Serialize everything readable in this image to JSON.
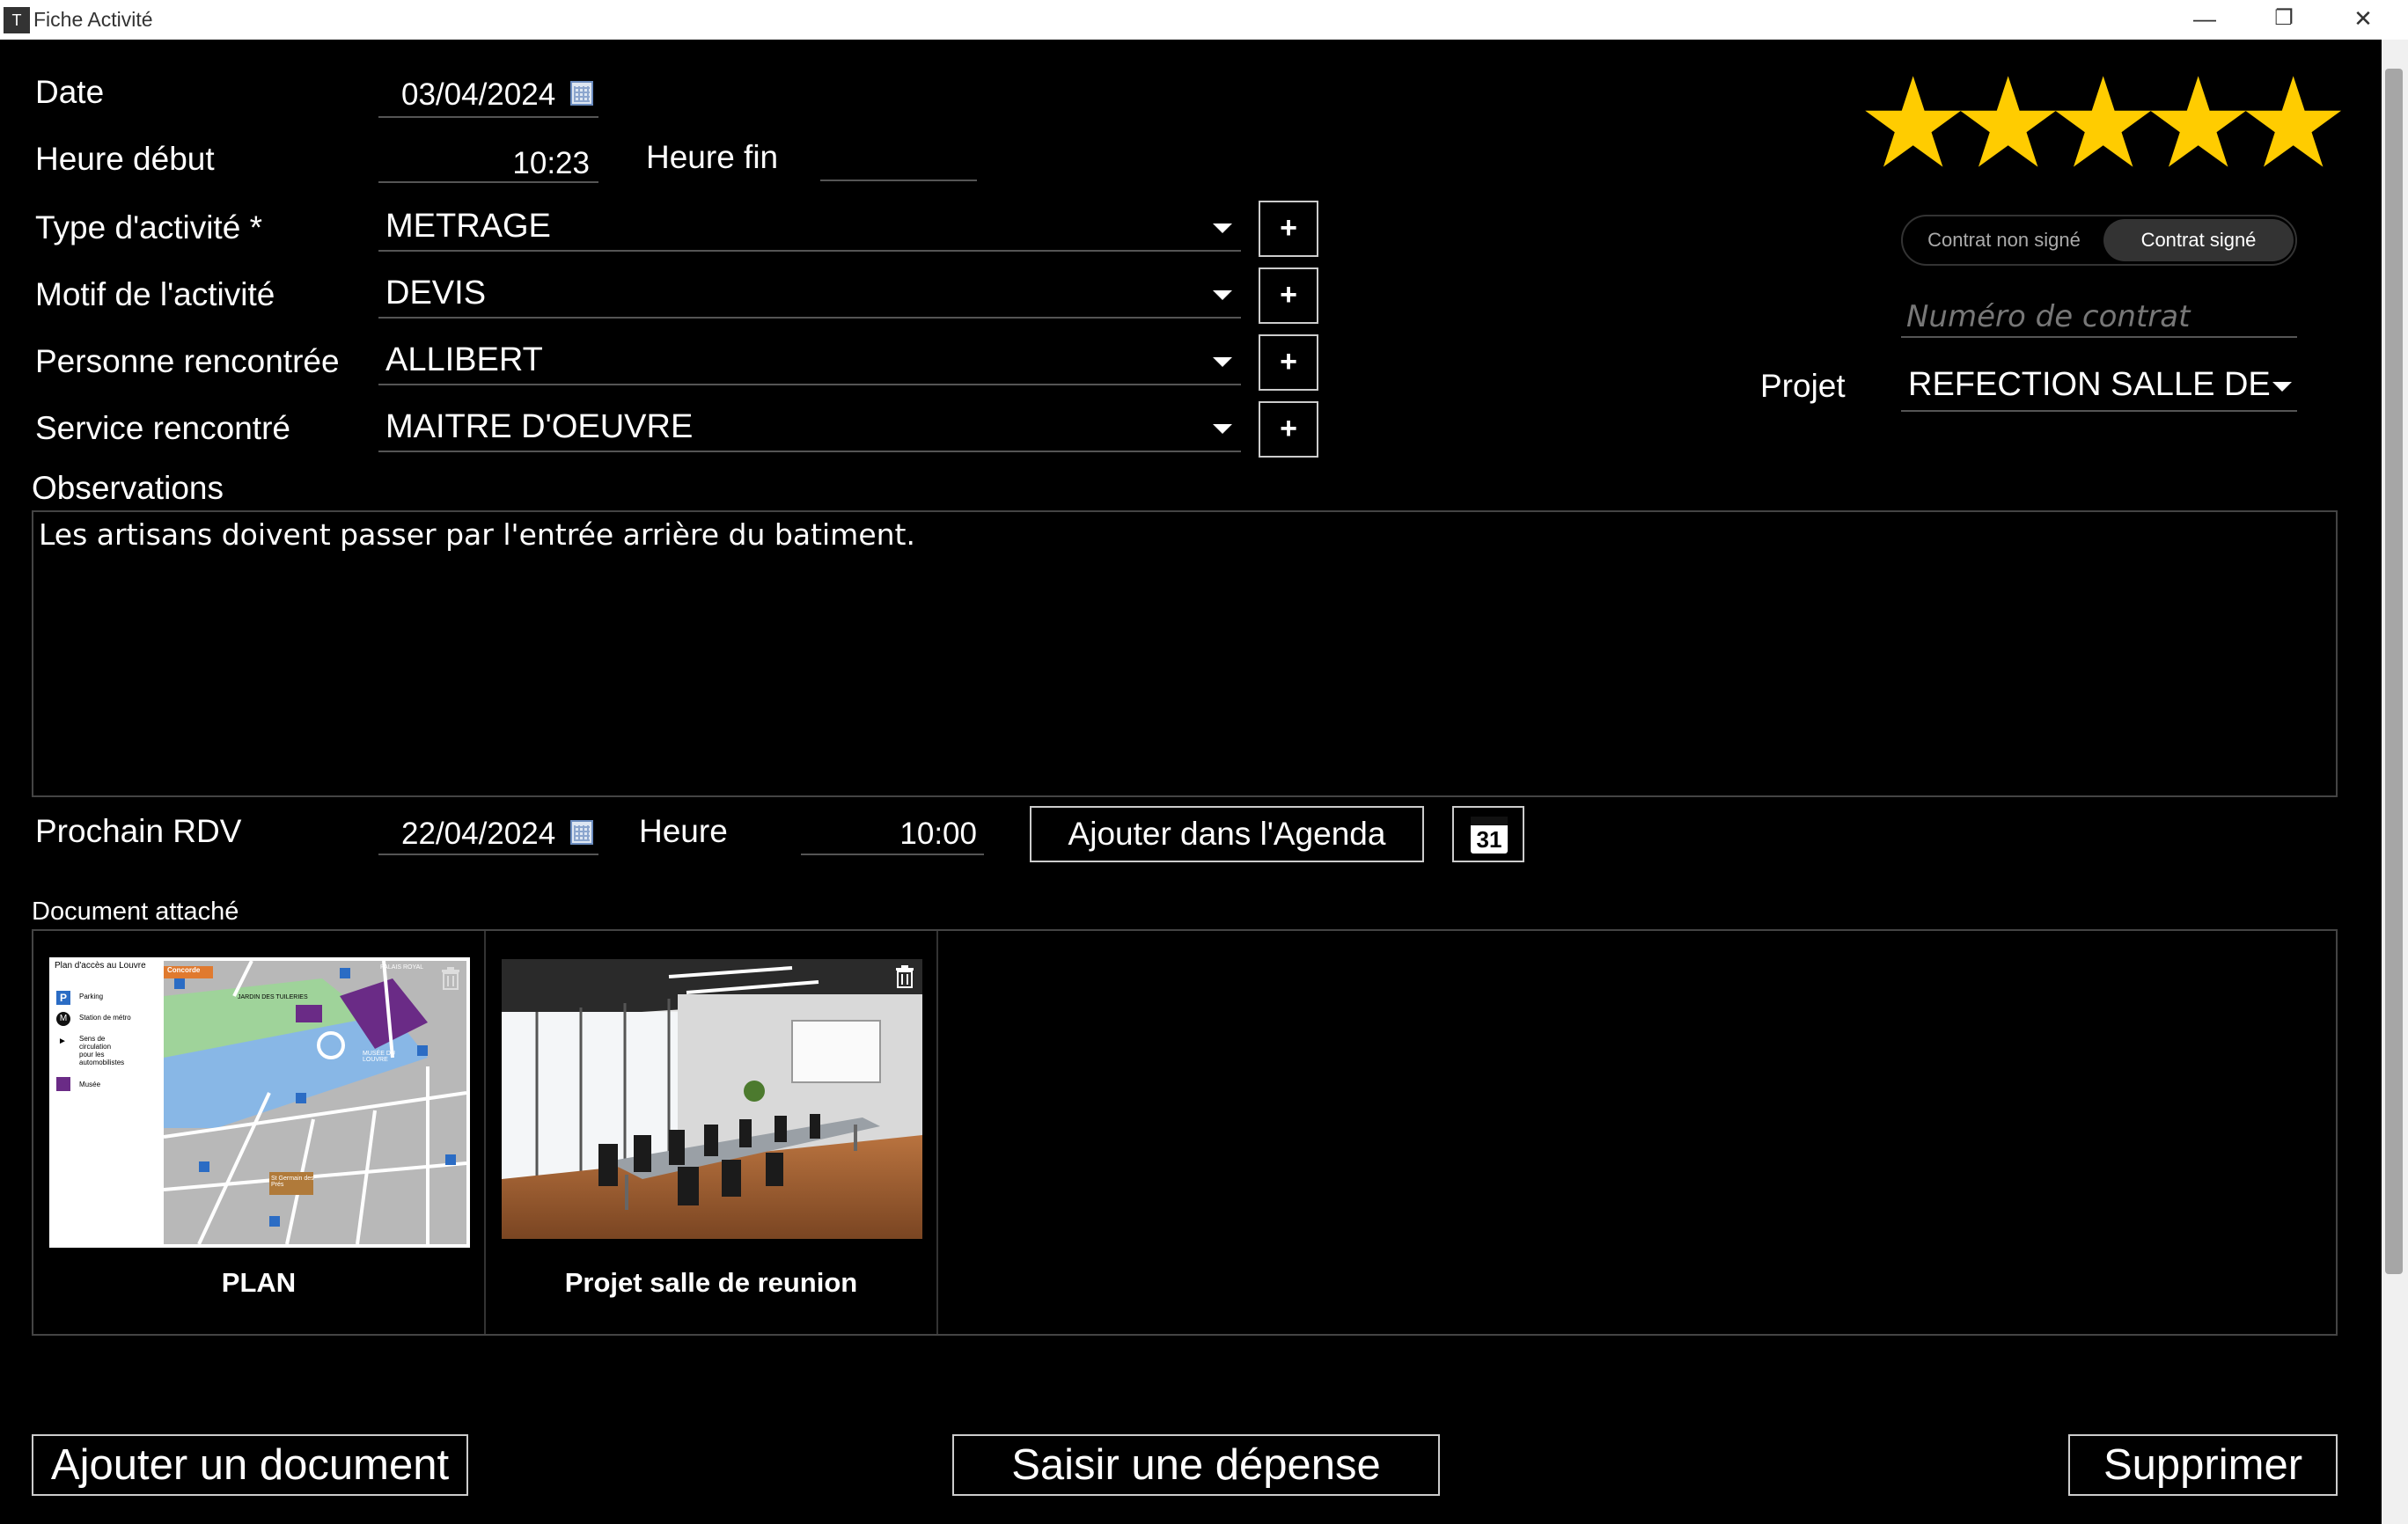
{
  "window": {
    "title": "Fiche Activité",
    "app_icon": "T",
    "controls": {
      "minimize": "—",
      "restore": "❐",
      "close": "✕"
    }
  },
  "form": {
    "date": {
      "label": "Date",
      "value": "03/04/2024"
    },
    "heure_debut": {
      "label": "Heure début",
      "value": "10:23"
    },
    "heure_fin": {
      "label": "Heure fin",
      "value": ""
    },
    "type_activite": {
      "label": "Type d'activité *",
      "value": "METRAGE"
    },
    "motif": {
      "label": "Motif de l'activité",
      "value": "DEVIS"
    },
    "personne": {
      "label": "Personne rencontrée",
      "value": "ALLIBERT"
    },
    "service": {
      "label": "Service rencontré",
      "value": "MAITRE D'OEUVRE"
    },
    "add_symbol": "+"
  },
  "rating": {
    "stars": 5,
    "max": 5,
    "color": "#ffcc00",
    "glyph": "★"
  },
  "contract": {
    "options": [
      "Contrat non signé",
      "Contrat signé"
    ],
    "selected": "Contrat signé",
    "number_placeholder": "Numéro de contrat",
    "project_label": "Projet",
    "project_value": "REFECTION SALLE DE"
  },
  "observations": {
    "label": "Observations",
    "text": "Les artisans doivent passer par l'entrée arrière du batiment."
  },
  "next_rdv": {
    "label": "Prochain RDV",
    "date": "22/04/2024",
    "time_label": "Heure",
    "time": "10:00",
    "agenda_button": "Ajouter dans l'Agenda",
    "calendar_day": "31"
  },
  "documents": {
    "label": "Document attaché",
    "items": [
      {
        "name": "PLAN",
        "thumb": "map",
        "map_title": "Plan d'accès au Louvre",
        "legend": [
          "Parking",
          "Station de métro",
          "Sens de circulation pour les automobilistes",
          "Musée"
        ],
        "map_labels": [
          "Concorde",
          "JARDIN DES TUILERIES",
          "PALAIS ROYAL",
          "MUSÉE DU LOUVRE",
          "St Germain des Prés"
        ]
      },
      {
        "name": "Projet salle de reunion",
        "thumb": "meeting-room"
      }
    ]
  },
  "actions": {
    "add_document": "Ajouter un document",
    "expense": "Saisir une dépense",
    "delete": "Supprimer"
  }
}
